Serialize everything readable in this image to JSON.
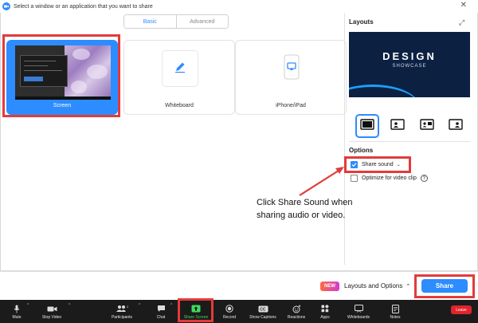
{
  "window": {
    "title": "Select a window or an application that you want to share",
    "close_icon": "close-icon"
  },
  "tabs": [
    {
      "label": "Basic",
      "active": true
    },
    {
      "label": "Advanced",
      "active": false
    }
  ],
  "share_options": [
    {
      "label": "Screen",
      "icon": "screen-thumbnail",
      "selected": true
    },
    {
      "label": "Whiteboard",
      "icon": "pen-icon",
      "selected": false
    },
    {
      "label": "iPhone/iPad",
      "icon": "phone-cast-icon",
      "selected": false
    }
  ],
  "layouts": {
    "title": "Layouts",
    "preview": {
      "headline": "DESIGN",
      "subtitle": "SHOWCASE"
    },
    "selected_index": 0
  },
  "options": {
    "title": "Options",
    "share_sound": {
      "label": "Share sound",
      "checked": true
    },
    "optimize_video": {
      "label": "Optimize for video clip",
      "checked": false
    }
  },
  "annotation": {
    "text": "Click Share Sound when sharing audio or video."
  },
  "footer": {
    "new_badge": "NEW",
    "layouts_options_label": "Layouts and Options",
    "share_button": "Share"
  },
  "toolbar": {
    "items": [
      {
        "label": "Mute",
        "icon": "microphone-icon"
      },
      {
        "label": "Stop Video",
        "icon": "video-camera-icon"
      },
      {
        "label": "Participants",
        "icon": "participants-icon",
        "count": "2"
      },
      {
        "label": "Chat",
        "icon": "chat-icon"
      },
      {
        "label": "Share Screen",
        "icon": "share-screen-icon"
      },
      {
        "label": "Record",
        "icon": "record-icon"
      },
      {
        "label": "Show Captions",
        "icon": "cc-icon"
      },
      {
        "label": "Reactions",
        "icon": "reactions-icon"
      },
      {
        "label": "Apps",
        "icon": "apps-icon"
      },
      {
        "label": "Whiteboards",
        "icon": "whiteboards-icon"
      },
      {
        "label": "Notes",
        "icon": "notes-icon"
      }
    ],
    "leave_label": "Leave"
  },
  "colors": {
    "accent": "#2d8cff",
    "highlight": "#e23b3b",
    "toolbar_bg": "#1b1b1b",
    "share_green": "#3ddc5a",
    "leave_red": "#e0242b"
  }
}
